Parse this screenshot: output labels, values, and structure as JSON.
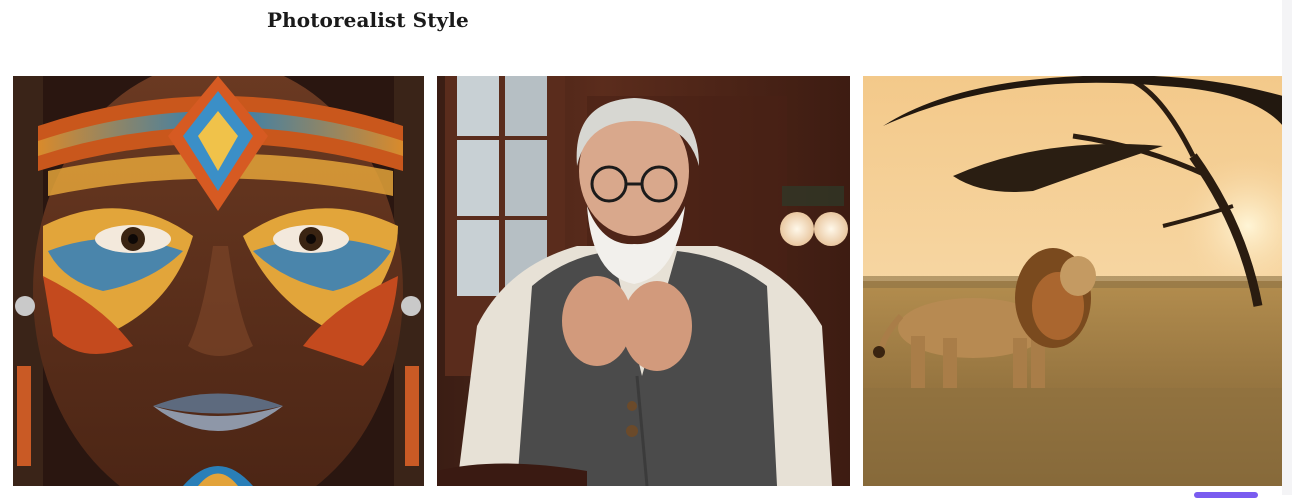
{
  "section": {
    "title": "Photorealist Style"
  },
  "gallery": {
    "images": [
      {
        "subject": "portrait-with-tribal-face-paint"
      },
      {
        "subject": "elderly-man-with-glasses-in-cafe"
      },
      {
        "subject": "lion-in-savanna-at-sunset"
      }
    ]
  },
  "colors": {
    "heading_text": "#1a1a1a",
    "accent": "#7a5cf0"
  }
}
